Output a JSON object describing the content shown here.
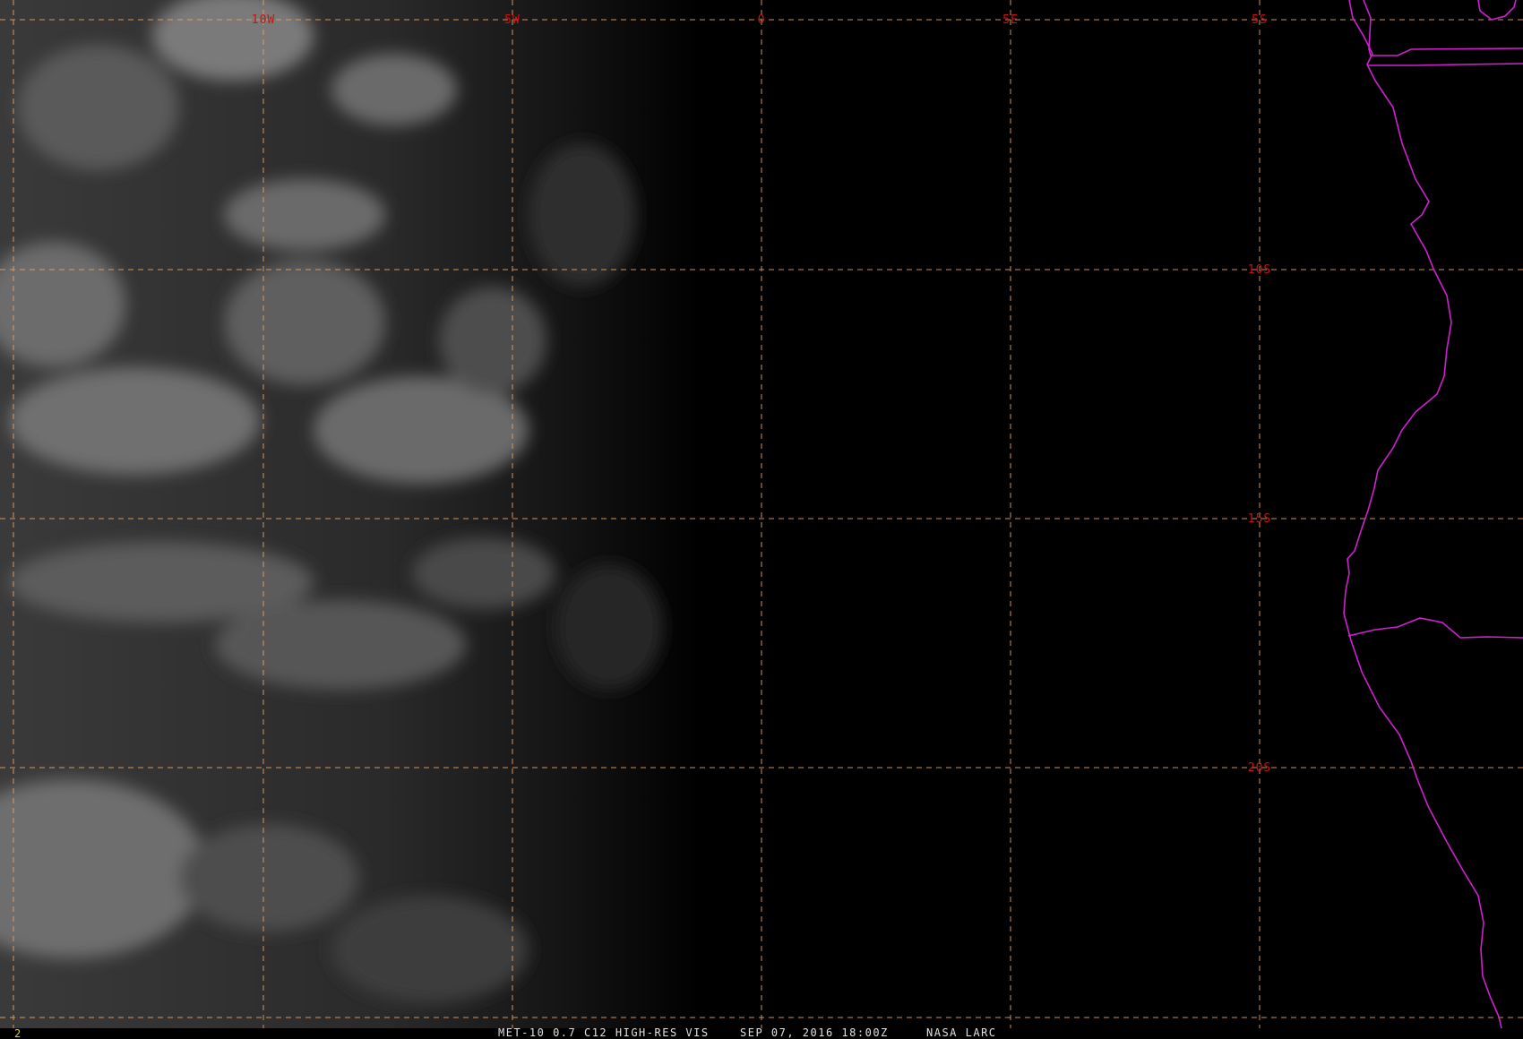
{
  "map": {
    "grid_color": "#e8a060",
    "label_color": "#d01010",
    "coastline_color": "#d020d0",
    "footer_color": "#e0e0e0",
    "frame_number_color": "#e0d000",
    "longitude_labels": [
      "10W",
      "5W",
      "0",
      "5E"
    ],
    "latitude_labels": [
      "5S",
      "10S",
      "15S",
      "20S"
    ],
    "frame_number": "2",
    "footer": {
      "product": "MET-10 0.7 C12 HIGH-RES VIS",
      "datetime": "SEP 07, 2016 18:00Z",
      "credit": "NASA LARC"
    }
  }
}
